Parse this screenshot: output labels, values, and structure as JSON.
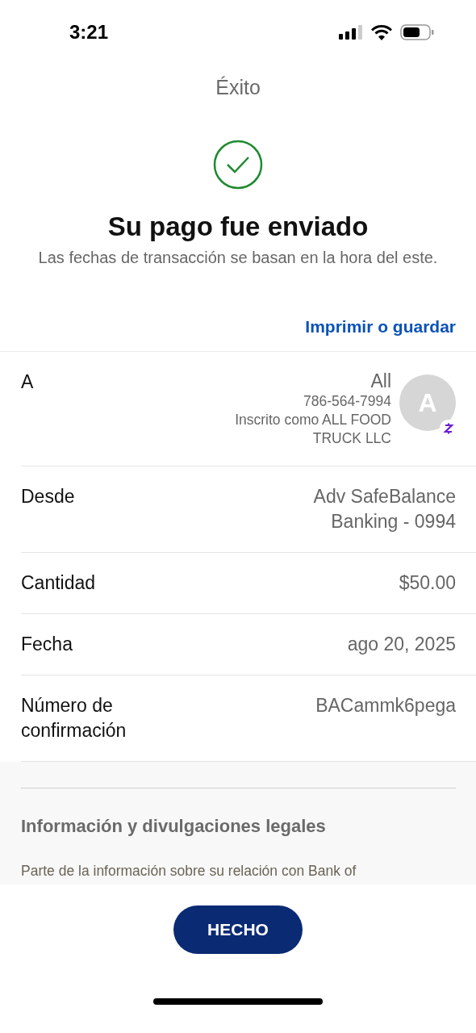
{
  "status_bar": {
    "time": "3:21"
  },
  "header": {
    "title": "Éxito"
  },
  "confirmation": {
    "heading": "Su pago fue enviado",
    "subtitle": "Las fechas de transacción se basan en la hora del este."
  },
  "print_link": "Imprimir o guardar",
  "details": [
    {
      "kind": "payee",
      "label": "A",
      "name": "All",
      "phone": "786-564-7994",
      "note": "Inscrito como ALL FOOD TRUCK LLC",
      "avatar": "A"
    },
    {
      "kind": "field",
      "label": "Desde",
      "value": "Adv SafeBalance Banking - 0994"
    },
    {
      "kind": "field",
      "label": "Cantidad",
      "value": "$50.00"
    },
    {
      "kind": "field",
      "label": "Fecha",
      "value": "ago 20, 2025"
    },
    {
      "kind": "field",
      "label": "Número de confirmación",
      "value": "BACammk6pega"
    }
  ],
  "legal": {
    "heading": "Información y divulgaciones legales",
    "text": "Parte de la información sobre su relación con Bank of"
  },
  "done_button": "HECHO"
}
